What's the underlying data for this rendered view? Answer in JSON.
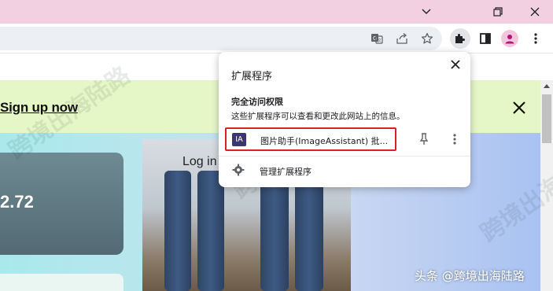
{
  "window": {
    "minimize_icon": "chevron-down-icon",
    "restore_icon": "restore-icon",
    "close_icon": "close-icon"
  },
  "toolbar": {
    "icons": [
      "translate-icon",
      "share-icon",
      "star-icon",
      "puzzle-icon",
      "side-panel-icon",
      "profile-icon",
      "more-vert-icon"
    ]
  },
  "page": {
    "signup_link": "Sign up now",
    "login_text": "Log in",
    "card_value": "2.72",
    "watermark": "跨境出海陆路",
    "credit": "头条 @跨境出海陆路"
  },
  "extensions_popup": {
    "title": "扩展程序",
    "access_heading": "完全访问权限",
    "access_description": "这些扩展程序可以查看和更改此网站上的信息。",
    "extension": {
      "logo_text": "IA",
      "name": "图片助手(ImageAssistant) 批..."
    },
    "manage_label": "管理扩展程序"
  },
  "colors": {
    "titlebar": "#f2cfe1",
    "banner": "#e6f7c7",
    "highlight_border": "#e02020",
    "extension_logo": "#3b3570"
  }
}
